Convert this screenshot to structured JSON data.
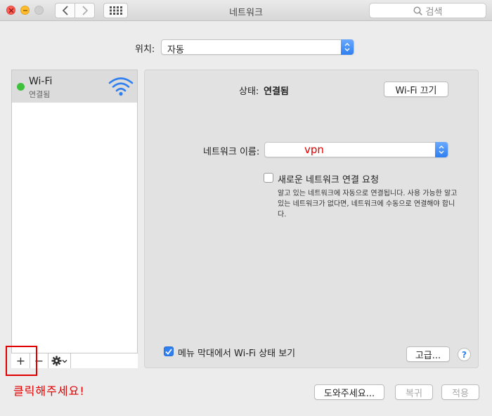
{
  "window": {
    "title": "네트워크"
  },
  "search": {
    "placeholder": "검색"
  },
  "location": {
    "label": "위치:",
    "value": "자동"
  },
  "sidebar": {
    "services": [
      {
        "name": "Wi-Fi",
        "status": "연결됨",
        "status_color": "#3dc13d"
      }
    ],
    "toolbar": {
      "add": "+",
      "remove": "−"
    }
  },
  "annotation": {
    "text": "클릭해주세요!",
    "color": "#e00000"
  },
  "panel": {
    "status_label": "상태:",
    "status_value": "연결됨",
    "wifi_off_button": "Wi-Fi 끄기",
    "network_name_label": "네트워크 이름:",
    "network_name_value": "vpn",
    "ask_join_label": "새로운 네트워크 연결 요청",
    "ask_join_checked": false,
    "ask_join_help": "알고 있는 네트워크에 자동으로 연결됩니다. 사용 가능한 알고 있는 네트워크가 없다면, 네트워크에 수동으로 연결해야 합니다.",
    "show_menu_label": "메뉴 막대에서 Wi-Fi 상태 보기",
    "show_menu_checked": true,
    "advanced_button": "고급...",
    "help_button": "?"
  },
  "footer": {
    "assist_button": "도와주세요...",
    "revert_button": "복귀",
    "apply_button": "적용"
  },
  "colors": {
    "accent": "#2f7ff0"
  }
}
